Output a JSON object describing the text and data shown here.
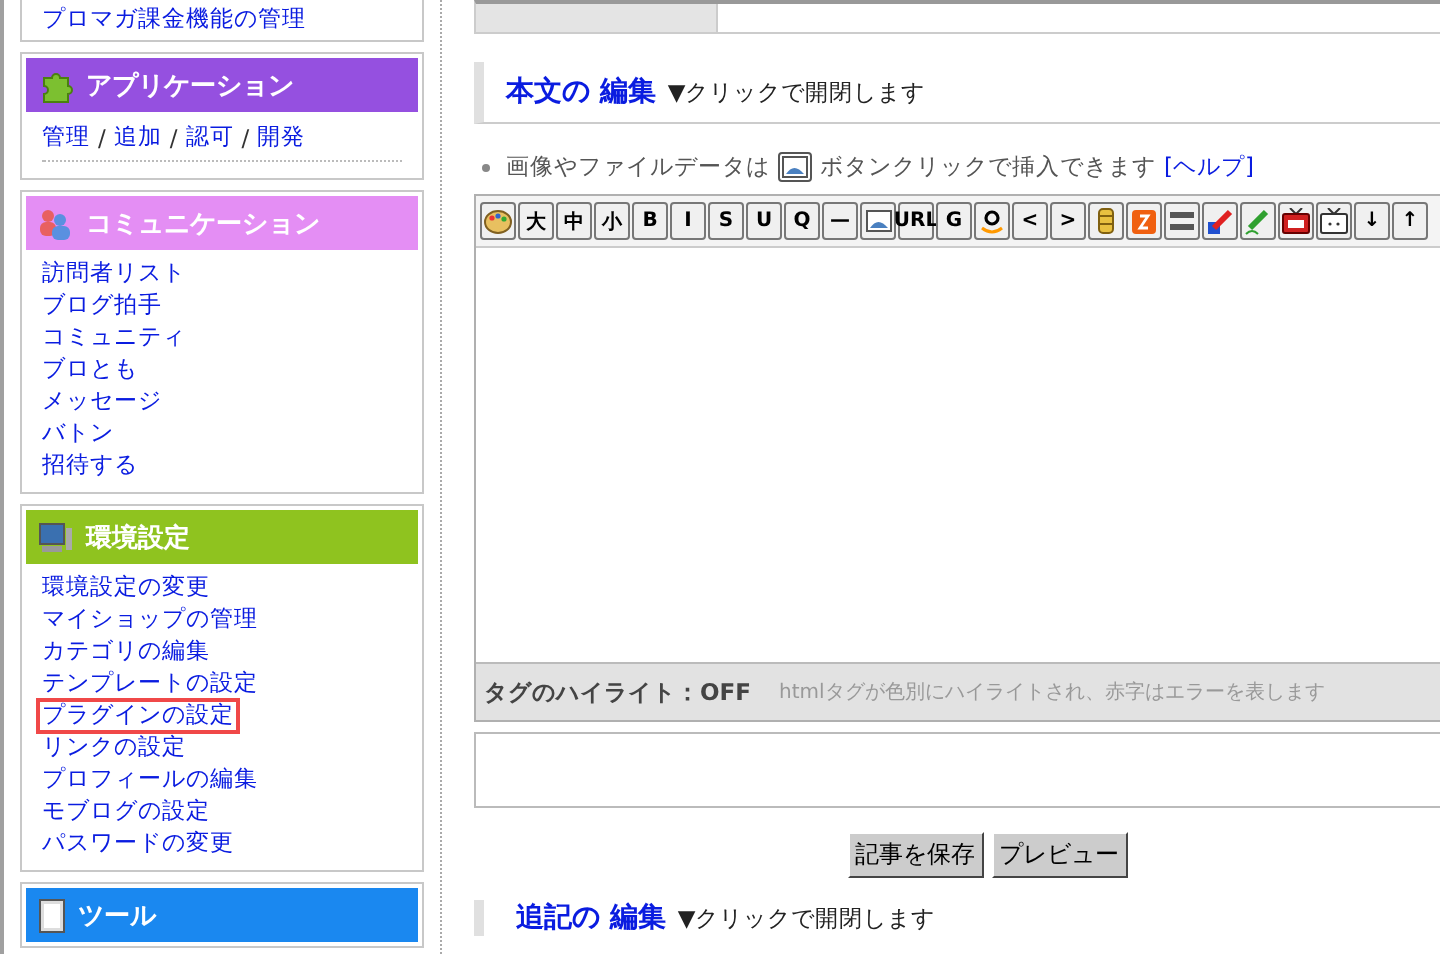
{
  "sidebar": {
    "top_link": "プロマガ課金機能の管理",
    "panels": [
      {
        "title": "アプリケーション",
        "kind": "inline",
        "color": "#9550e0",
        "links": [
          {
            "label": "管理",
            "highlighted": false
          },
          {
            "label": "追加",
            "highlighted": false
          },
          {
            "label": "認可",
            "highlighted": false
          },
          {
            "label": "開発",
            "highlighted": false
          }
        ],
        "separator": "/"
      },
      {
        "title": "コミュニケーション",
        "kind": "list",
        "color": "#e48ef4",
        "links": [
          {
            "label": "訪問者リスト",
            "highlighted": false
          },
          {
            "label": "ブログ拍手",
            "highlighted": false
          },
          {
            "label": "コミュニティ",
            "highlighted": false
          },
          {
            "label": "ブロとも",
            "highlighted": false
          },
          {
            "label": "メッセージ",
            "highlighted": false
          },
          {
            "label": "バトン",
            "highlighted": false
          },
          {
            "label": "招待する",
            "highlighted": false
          }
        ]
      },
      {
        "title": "環境設定",
        "kind": "list",
        "color": "#8fc31f",
        "links": [
          {
            "label": "環境設定の変更",
            "highlighted": false
          },
          {
            "label": "マイショップの管理",
            "highlighted": false
          },
          {
            "label": "カテゴリの編集",
            "highlighted": false
          },
          {
            "label": "テンプレートの設定",
            "highlighted": false
          },
          {
            "label": "プラグインの設定",
            "highlighted": true
          },
          {
            "label": "リンクの設定",
            "highlighted": false
          },
          {
            "label": "プロフィールの編集",
            "highlighted": false
          },
          {
            "label": "モブログの設定",
            "highlighted": false
          },
          {
            "label": "パスワードの変更",
            "highlighted": false
          }
        ]
      },
      {
        "title": "ツール",
        "kind": "header",
        "color": "#1a88f0"
      }
    ]
  },
  "main": {
    "section": {
      "title": "本文の 編集",
      "hint": "▼クリックで開閉します"
    },
    "info": {
      "before": "画像やファイルデータは",
      "after": "ボタンクリックで挿入できます",
      "link": "[ヘルプ]"
    },
    "toolbar": [
      {
        "kind": "icon"
      },
      {
        "kind": "text",
        "label": "大"
      },
      {
        "kind": "text",
        "label": "中"
      },
      {
        "kind": "text",
        "label": "小"
      },
      {
        "kind": "text",
        "label": "B"
      },
      {
        "kind": "text",
        "label": "I"
      },
      {
        "kind": "text",
        "label": "S"
      },
      {
        "kind": "text",
        "label": "U"
      },
      {
        "kind": "text",
        "label": "Q"
      },
      {
        "kind": "text",
        "label": "—"
      },
      {
        "kind": "icon"
      },
      {
        "kind": "text",
        "label": "URL"
      },
      {
        "kind": "text",
        "label": "G"
      },
      {
        "kind": "icon"
      },
      {
        "kind": "text",
        "label": "<"
      },
      {
        "kind": "text",
        "label": ">"
      },
      {
        "kind": "icon"
      },
      {
        "kind": "icon"
      },
      {
        "kind": "icon"
      },
      {
        "kind": "icon"
      },
      {
        "kind": "icon"
      },
      {
        "kind": "icon"
      },
      {
        "kind": "icon"
      },
      {
        "kind": "text",
        "label": "↓"
      },
      {
        "kind": "text",
        "label": "↑"
      }
    ],
    "highlight": {
      "label": "タグのハイライト：OFF",
      "hint": "htmlタグが色別にハイライトされ、赤字はエラーを表します"
    },
    "buttons": [
      "記事を保存",
      "プレビュー"
    ],
    "next_section": {
      "title": "追記の 編集",
      "hint": "▼クリックで開閉します"
    }
  }
}
